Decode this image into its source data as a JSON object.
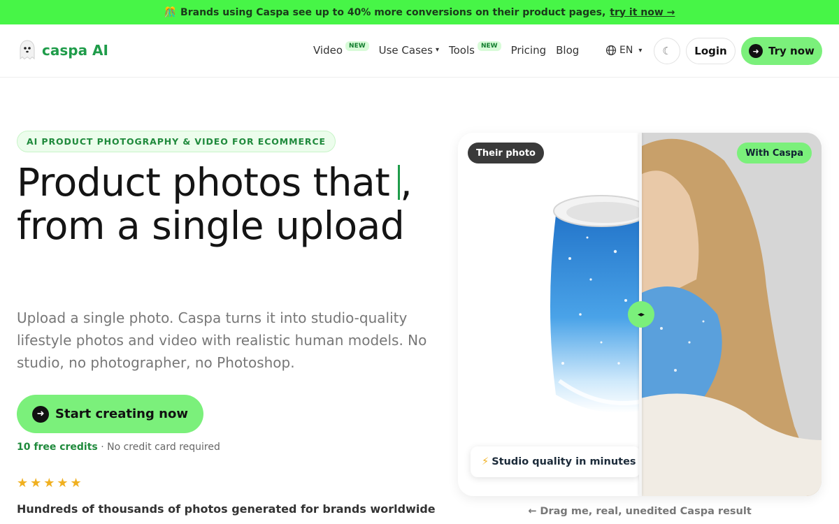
{
  "banner": {
    "emoji": "🎊",
    "text": "Brands using Caspa see up to 40% more conversions on their product pages,",
    "link": "try it now →"
  },
  "nav": {
    "logo_text": "caspa AI",
    "links": [
      {
        "label": "Video",
        "badge": "NEW"
      },
      {
        "label": "Use Cases",
        "caret": "▾"
      },
      {
        "label": "Tools",
        "badge": "NEW"
      },
      {
        "label": "Pricing"
      },
      {
        "label": "Blog"
      }
    ],
    "language": "EN",
    "language_caret": "▾",
    "theme_icon": "☾",
    "login_label": "Login",
    "try_label": "Try now"
  },
  "hero": {
    "eyebrow": "AI PRODUCT PHOTOGRAPHY & VIDEO FOR ECOMMERCE",
    "headline_line1": "Product photos that",
    "headline_punct": ",",
    "headline_line2": "from a single upload",
    "subtext": "Upload a single photo. Caspa turns it into studio-quality lifestyle photos and video with realistic human models. No studio, no photographer, no Photoshop.",
    "cta_label": "Start creating now",
    "credits_strong": "10 free credits",
    "credits_rest": " · No credit card required",
    "stars": "★★★★★",
    "rating": 5,
    "social_proof": "Hundreds of thousands of photos generated for brands worldwide"
  },
  "compare": {
    "left_tag": "Their photo",
    "right_tag": "With Caspa",
    "quality_icon": "⚡",
    "quality_text": "Studio quality in minutes",
    "handle_icon": "◂▸",
    "caption": "← Drag me, real, unedited Caspa result",
    "split_fraction": 0.5
  },
  "colors": {
    "banner_bg": "#47f547",
    "accent": "#7bf07b",
    "brand_text": "#1f9c4a",
    "star": "#f0b020"
  }
}
